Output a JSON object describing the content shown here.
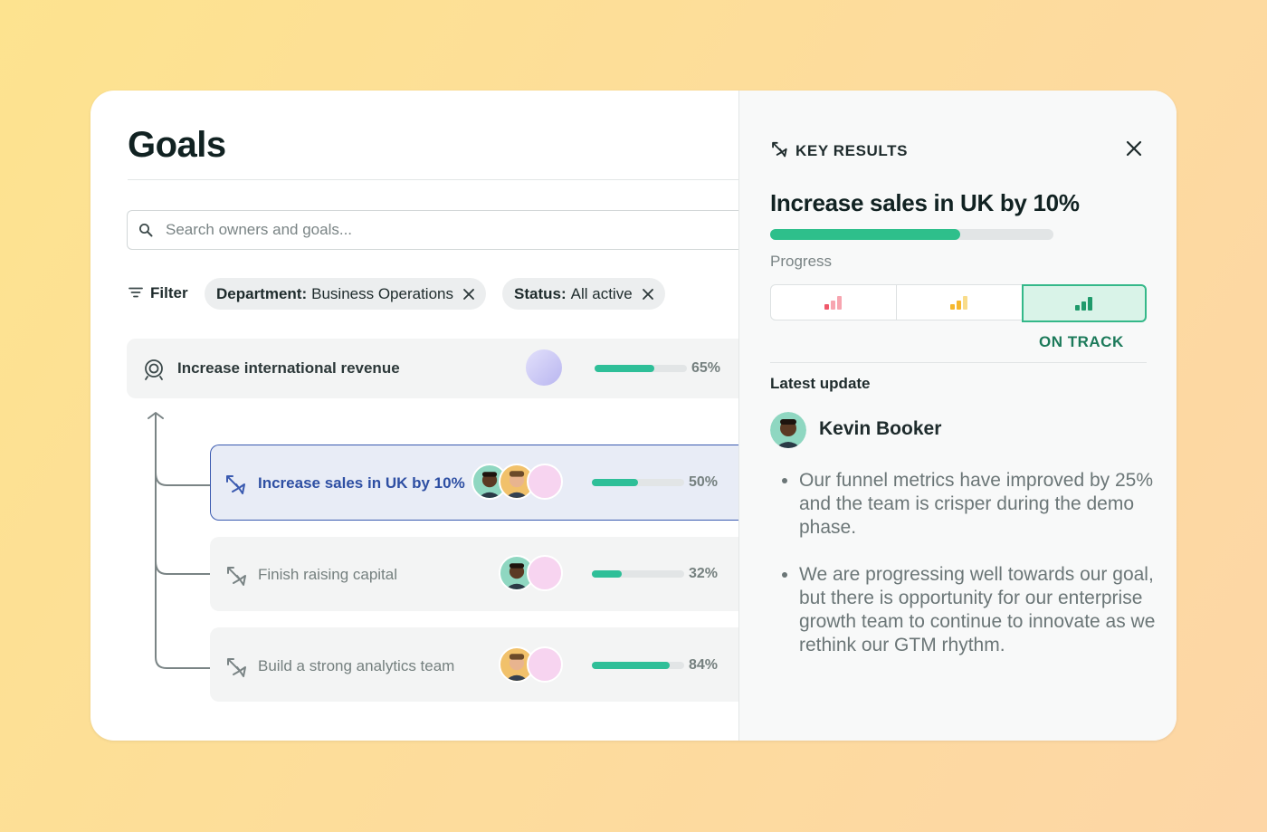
{
  "goals": {
    "title": "Goals",
    "search_placeholder": "Search owners and goals...",
    "filter_label": "Filter",
    "chips": [
      {
        "key": "Department:",
        "value": "Business Operations"
      },
      {
        "key": "Status:",
        "value": "All active"
      }
    ],
    "parent_goal": {
      "label": "Increase international revenue",
      "progress": 65,
      "pct_text": "65%"
    },
    "key_results": [
      {
        "label": "Increase sales in UK by 10%",
        "progress": 50,
        "pct_text": "50%",
        "selected": true
      },
      {
        "label": "Finish raising capital",
        "progress": 32,
        "pct_text": "32%",
        "selected": false
      },
      {
        "label": "Build a strong analytics team",
        "progress": 84,
        "pct_text": "84%",
        "selected": false
      }
    ]
  },
  "panel": {
    "header": "KEY RESULTS",
    "title": "Increase sales in UK by 10%",
    "progress": 67,
    "progress_label": "Progress",
    "status_options": [
      "off-track",
      "at-risk",
      "on-track"
    ],
    "status_selected": "on-track",
    "status_label": "ON TRACK",
    "latest_update_label": "Latest update",
    "author": "Kevin Booker",
    "updates": [
      "Our funnel metrics have improved by 25% and the team is crisper during the demo phase.",
      "We are progressing well towards our goal, but there is opportunity for our enterprise growth team to continue to innovate as we rethink our GTM rhythm."
    ]
  },
  "colors": {
    "accent_green": "#2ebf98",
    "selected_blue": "#3a5ab0",
    "status_green": "#1c7a5a",
    "off_track_red": "#f0596b",
    "at_risk_yellow": "#f5b82e"
  }
}
